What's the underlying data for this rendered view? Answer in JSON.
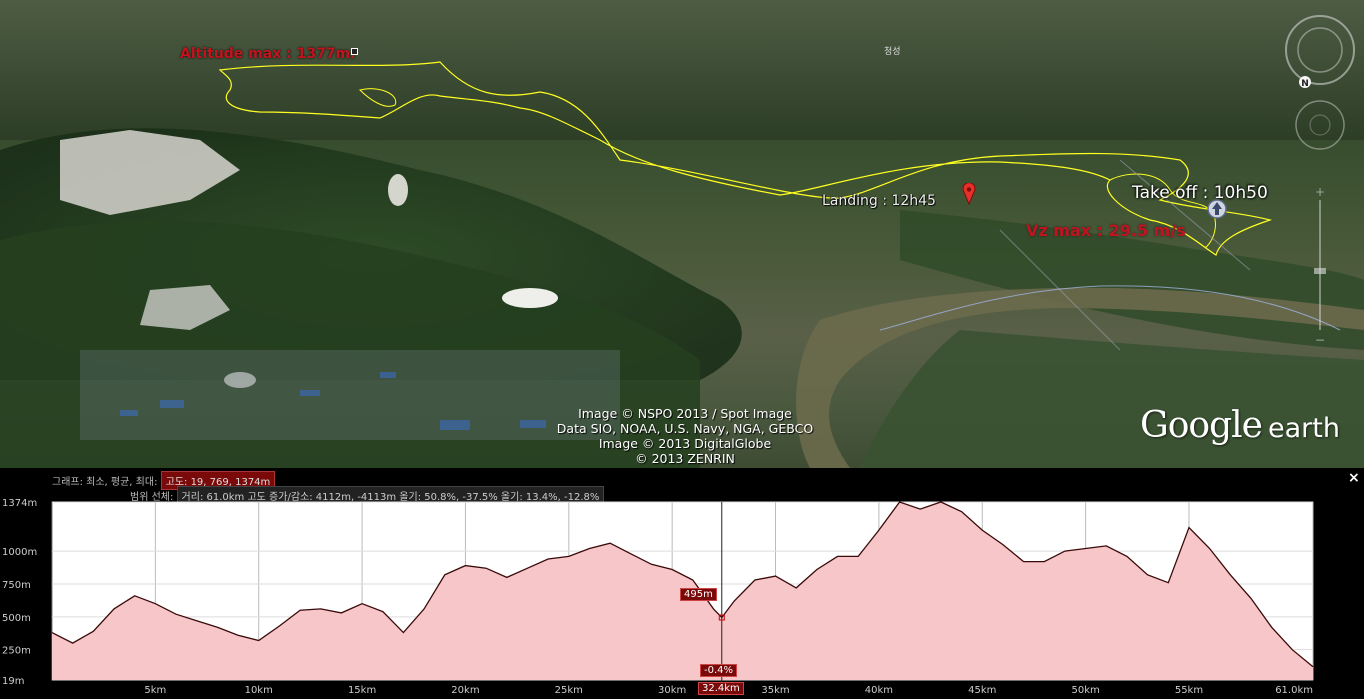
{
  "map": {
    "altitude_max_label": "Altitude max : 1377m.",
    "landing_label": "Landing : 12h45",
    "takeoff_label": "Take off : 10h50",
    "vz_label": "Vz max : 29.5 m/s",
    "place_label": "청성",
    "attribution": [
      "Image © NSPO 2013 / Spot Image",
      "Data SIO, NOAA, U.S. Navy, NGA, GEBCO",
      "Image © 2013 DigitalGlobe",
      "© 2013 ZENRIN"
    ],
    "brand_google": "Google",
    "brand_earth": "earth",
    "compass_letter": "N",
    "track_color": "#ffff22"
  },
  "panel": {
    "row1_label": "그래프: 최소, 평균, 최대:",
    "row1_value": "고도: 19, 769, 1374m",
    "row2_label": "범위 선체:",
    "row2_value": "거리: 61.0km 고도 증가/감소: 4112m, -4113m 올기: 50.8%, -37.5% 올기: 13.4%, -12.8%",
    "close_label": "×",
    "cursor_elevation": "495m",
    "cursor_slope": "-0.4%",
    "cursor_distance": "32.4km",
    "fill_color": "#f6c6c8",
    "line_color": "#3a0a0a"
  },
  "chart_data": {
    "type": "area",
    "title": "",
    "xlabel": "",
    "ylabel": "",
    "ylim": [
      19,
      1374
    ],
    "xlim": [
      0,
      61.0
    ],
    "y_ticks": [
      "19m",
      "250m",
      "500m",
      "750m",
      "1000m",
      "1374m"
    ],
    "y_tick_values": [
      19,
      250,
      500,
      750,
      1000,
      1374
    ],
    "x_ticks": [
      "5km",
      "10km",
      "15km",
      "20km",
      "25km",
      "30km",
      "35km",
      "40km",
      "45km",
      "50km",
      "55km",
      "61.0km"
    ],
    "x_tick_values": [
      5,
      10,
      15,
      20,
      25,
      30,
      35,
      40,
      45,
      50,
      55,
      61
    ],
    "x": [
      0,
      1,
      2,
      3,
      4,
      5,
      6,
      7,
      8,
      9,
      10,
      11,
      12,
      13,
      14,
      15,
      16,
      17,
      18,
      19,
      20,
      21,
      22,
      23,
      24,
      25,
      26,
      27,
      28,
      29,
      30,
      31,
      32,
      32.4,
      33,
      34,
      35,
      36,
      37,
      38,
      39,
      40,
      41,
      42,
      43,
      44,
      45,
      46,
      47,
      48,
      49,
      50,
      51,
      52,
      53,
      54,
      55,
      56,
      57,
      58,
      59,
      60,
      61
    ],
    "y": [
      380,
      300,
      390,
      560,
      660,
      600,
      520,
      470,
      420,
      360,
      320,
      430,
      550,
      560,
      530,
      600,
      540,
      380,
      560,
      820,
      890,
      870,
      800,
      870,
      940,
      960,
      1020,
      1060,
      980,
      900,
      860,
      780,
      560,
      495,
      620,
      780,
      810,
      720,
      860,
      960,
      960,
      1160,
      1380,
      1320,
      1380,
      1300,
      1160,
      1050,
      920,
      920,
      1000,
      1020,
      1040,
      960,
      820,
      760,
      1180,
      1020,
      820,
      640,
      420,
      250,
      120
    ]
  }
}
